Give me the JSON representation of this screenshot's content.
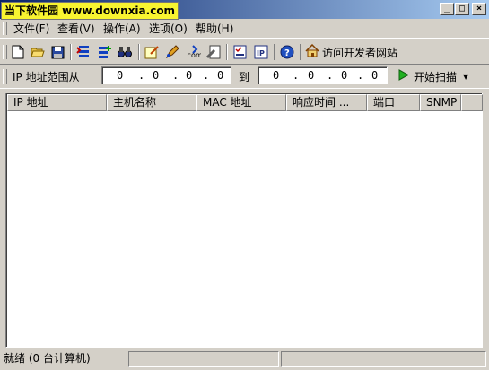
{
  "titlebar": {
    "watermark": "当下软件园 www.downxia.com",
    "title": "",
    "min_glyph": "_",
    "max_glyph": "□",
    "close_glyph": "×"
  },
  "menu": {
    "items": [
      {
        "label": "文件(F)"
      },
      {
        "label": "查看(V)"
      },
      {
        "label": "操作(A)"
      },
      {
        "label": "选项(O)"
      },
      {
        "label": "帮助(H)"
      }
    ]
  },
  "toolbar": {
    "developer_link": "访问开发者网站",
    "icons": [
      "new-file-icon",
      "open-folder-icon",
      "save-disk-icon",
      "import-list-icon",
      "add-list-icon",
      "find-binoculars-icon",
      "note-edit-icon",
      "pen-tool-icon",
      "dot-com-icon",
      "wrench-doc-icon",
      "checklist-icon",
      "ip-icon",
      "help-icon",
      "home-icon"
    ]
  },
  "range": {
    "from_label": "IP 地址范围从",
    "start_ip": [
      "0",
      "0",
      "0",
      "0"
    ],
    "to_label": "到",
    "end_ip": [
      "0",
      "0",
      "0",
      "0"
    ],
    "scan_label": "开始扫描",
    "scan_arrow": "▼"
  },
  "list": {
    "columns": [
      "IP 地址",
      "主机名称",
      "MAC 地址",
      "响应时间 ...",
      "端口",
      "SNMP"
    ]
  },
  "status": {
    "text": "就绪 (0 台计算机)",
    "panel2": "",
    "panel3": ""
  },
  "colors": {
    "title_gradient_start": "#0a246a",
    "title_gradient_end": "#a6caf0",
    "watermark_bg": "#f8f430",
    "chrome": "#d4d0c8"
  }
}
